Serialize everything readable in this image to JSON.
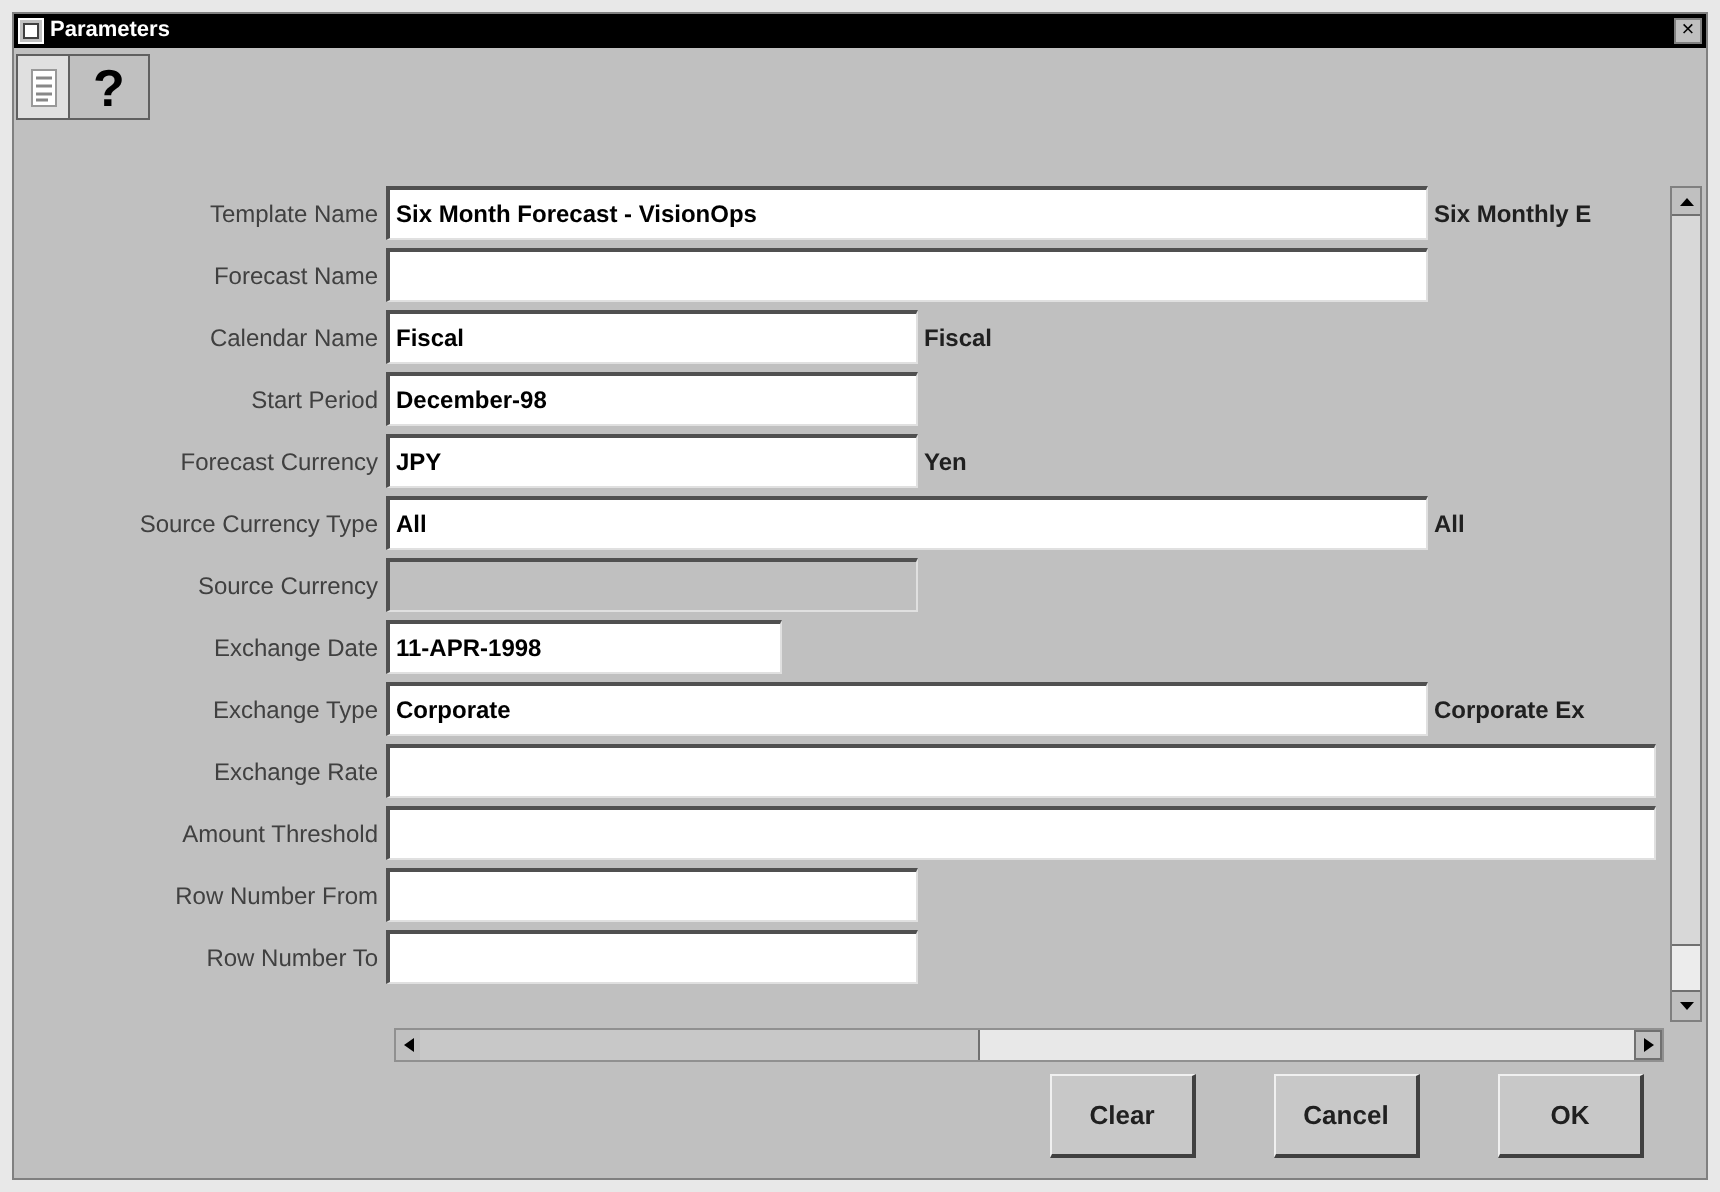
{
  "window": {
    "title": "Parameters",
    "close": "×"
  },
  "toolbar": {
    "help": "?"
  },
  "fields": [
    {
      "label": "Template Name",
      "value": "Six Month Forecast - VisionOps",
      "kind": "wide",
      "disabled": false,
      "description": "Six Monthly E"
    },
    {
      "label": "Forecast Name",
      "kind": "wide",
      "disabled": false
    },
    {
      "label": "Calendar Name",
      "value": "Fiscal",
      "kind": "medium",
      "disabled": false,
      "description": "Fiscal"
    },
    {
      "label": "Start Period",
      "value": "December-98",
      "kind": "medium",
      "disabled": false
    },
    {
      "label": "Forecast Currency",
      "value": "JPY",
      "kind": "medium",
      "disabled": false,
      "description": "Yen"
    },
    {
      "label": "Source Currency Type",
      "value": "All",
      "kind": "wide",
      "disabled": false,
      "description": "All"
    },
    {
      "label": "Source Currency",
      "kind": "medium",
      "disabled": true
    },
    {
      "label": "Exchange Date",
      "value": "11-APR-1998",
      "kind": "short",
      "disabled": false
    },
    {
      "label": "Exchange Type",
      "value": "Corporate",
      "kind": "wide",
      "disabled": false,
      "description": "Corporate Ex"
    },
    {
      "label": "Exchange Rate",
      "kind": "full",
      "disabled": false
    },
    {
      "label": "Amount Threshold",
      "kind": "full",
      "disabled": false
    },
    {
      "label": "Row Number From",
      "kind": "medium",
      "disabled": false
    },
    {
      "label": "Row Number To",
      "kind": "medium",
      "disabled": false
    }
  ],
  "buttons": [
    "Clear",
    "Cancel",
    "OK"
  ]
}
